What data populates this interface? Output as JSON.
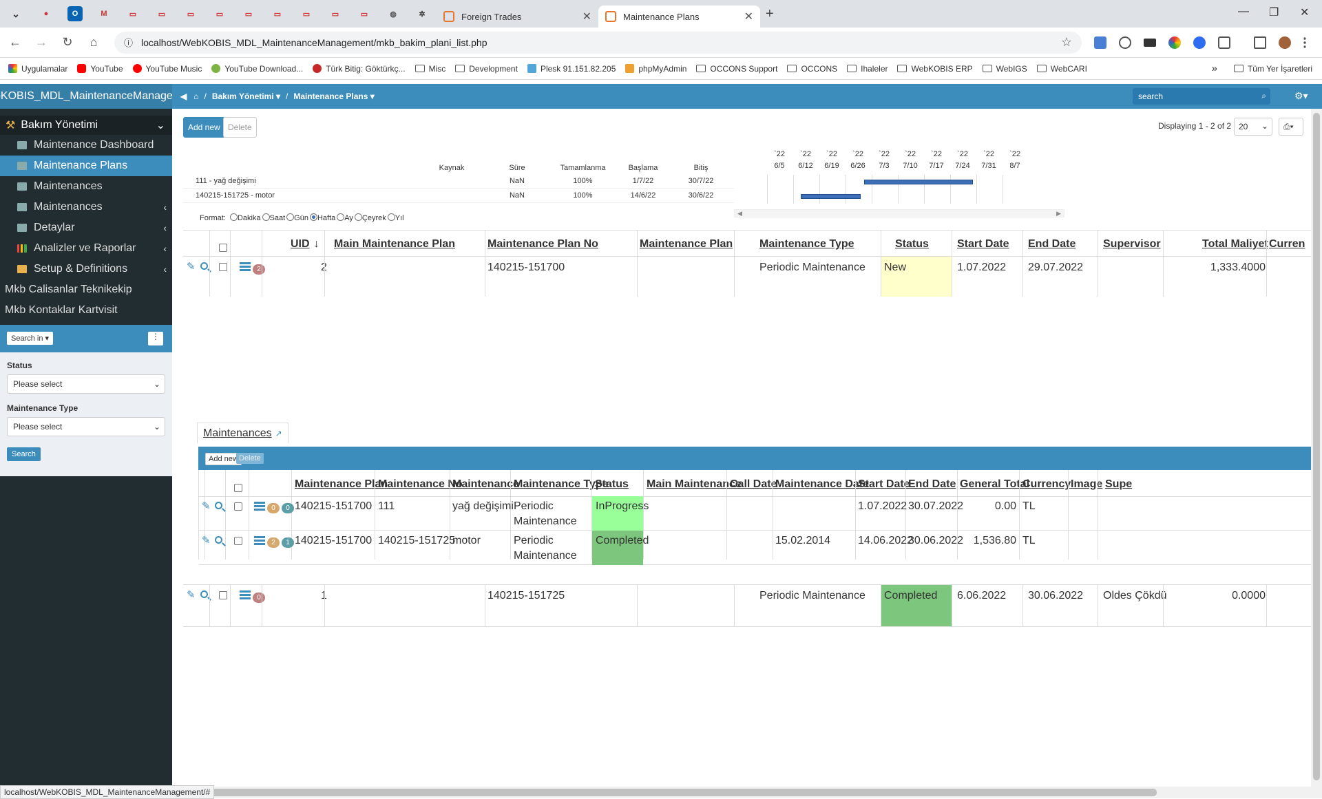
{
  "browser": {
    "tabs": [
      {
        "label": "Foreign Trades"
      },
      {
        "label": "Maintenance Plans"
      }
    ],
    "url": "localhost/WebKOBIS_MDL_MaintenanceManagement/mkb_bakim_plani_list.php",
    "bookmarks": [
      "Uygulamalar",
      "YouTube",
      "YouTube Music",
      "YouTube Download...",
      "Türk Bitig: Göktürkç...",
      "Misc",
      "Development",
      "Plesk 91.151.82.205",
      "phpMyAdmin",
      "OCCONS Support",
      "OCCONS",
      "Ihaleler",
      "WebKOBIS ERP",
      "WebIGS",
      "WebCARI"
    ],
    "bookmarks_more": "»",
    "other_bookmarks": "Tüm Yer İşaretleri",
    "status_url": "localhost/WebKOBIS_MDL_MaintenanceManagement/#"
  },
  "app": {
    "brand": "bKOBIS_MDL_MaintenanceManagem",
    "breadcrumb": [
      "Bakım Yönetimi",
      "Maintenance Plans"
    ],
    "search_placeholder": "search"
  },
  "sidebar": {
    "group": "Bakım Yönetimi",
    "items": [
      {
        "label": "Maintenance Dashboard",
        "active": false
      },
      {
        "label": "Maintenance Plans",
        "active": true
      },
      {
        "label": "Maintenances",
        "active": false
      },
      {
        "label": "Maintenances",
        "active": false
      },
      {
        "label": "Detaylar",
        "active": false
      },
      {
        "label": "Analizler ve Raporlar",
        "active": false
      },
      {
        "label": "Setup & Definitions",
        "active": false
      }
    ],
    "plain_items": [
      "Mkb Calisanlar Teknikekip",
      "Mkb Kontaklar Kartvisit"
    ],
    "search_in": "Search in",
    "filters": [
      {
        "label": "Status",
        "value": "Please select"
      },
      {
        "label": "Maintenance Type",
        "value": "Please select"
      }
    ],
    "search_button": "Search"
  },
  "toolbar": {
    "add_new": "Add new",
    "delete": "Delete",
    "displaying": "Displaying 1 - 2 of 2",
    "page_size": "20"
  },
  "gantt": {
    "columns": [
      "Kaynak",
      "Süre",
      "Tamamlanma",
      "Başlama",
      "Bitiş"
    ],
    "weeks": [
      "`22 6/5",
      "`22 6/12",
      "`22 6/19",
      "`22 6/26",
      "`22 7/3",
      "`22 7/10",
      "`22 7/17",
      "`22 7/24",
      "`22 7/31",
      "`22 8/7"
    ],
    "rows": [
      {
        "name": "111 - yağ değişimi",
        "kaynak": "",
        "sure": "NaN",
        "tamamlanma": "100%",
        "baslama": "1/7/22",
        "bitis": "30/7/22",
        "bar_start": "2022-07-01",
        "bar_end": "2022-07-30"
      },
      {
        "name": "140215-151725 - motor",
        "kaynak": "",
        "sure": "NaN",
        "tamamlanma": "100%",
        "baslama": "14/6/22",
        "bitis": "30/6/22",
        "bar_start": "2022-06-14",
        "bar_end": "2022-06-30"
      }
    ],
    "format_label": "Format:",
    "format_options": [
      "Dakika",
      "Saat",
      "Gün",
      "Hafta",
      "Ay",
      "Çeyrek",
      "Yıl"
    ],
    "format_selected": "Hafta"
  },
  "main_table": {
    "headers": [
      "UID",
      "Main Maintenance Plan",
      "Maintenance Plan No",
      "Maintenance Plan",
      "Maintenance Type",
      "Status",
      "Start Date",
      "End Date",
      "Supervisor",
      "Total Maliyet",
      "Curren"
    ],
    "rows": [
      {
        "badge": "2",
        "uid": "2",
        "main_plan": "",
        "plan_no": "140215-151700",
        "plan": "",
        "type": "Periodic Maintenance",
        "status": "New",
        "status_color": "#ffffcc",
        "start": "1.07.2022",
        "end": "29.07.2022",
        "supervisor": "",
        "total": "1,333.4000",
        "currency": ""
      },
      {
        "badge": "0",
        "uid": "1",
        "main_plan": "",
        "plan_no": "140215-151725",
        "plan": "",
        "type": "Periodic Maintenance",
        "status": "Completed",
        "status_color": "#7dc67d",
        "start": "6.06.2022",
        "end": "30.06.2022",
        "supervisor": "Oldes Çökdü",
        "total": "0.0000",
        "currency": ""
      }
    ]
  },
  "detail": {
    "tab_label": "Maintenances",
    "add_new": "Add new",
    "delete": "Delete",
    "headers": [
      "Maintenance Plan",
      "Maintenance No",
      "Maintenance",
      "Maintenance Type",
      "Status",
      "Main Maintenance",
      "Call Date",
      "Maintenance Date",
      "Start Date",
      "End Date",
      "General Total",
      "Currency",
      "Image",
      "Supe"
    ],
    "rows": [
      {
        "b1": "0",
        "b2": "0",
        "plan": "140215-151700",
        "no": "111",
        "maint": "yağ değişimi",
        "type1": "Periodic",
        "type2": "Maintenance",
        "status": "InProgress",
        "status_color": "#99ff99",
        "main": "",
        "call": "",
        "mdate": "",
        "start": "1.07.2022",
        "end": "30.07.2022",
        "total": "0.00",
        "currency": "TL"
      },
      {
        "b1": "2",
        "b2": "1",
        "plan": "140215-151700",
        "no": "140215-151725",
        "maint": "motor",
        "type1": "Periodic",
        "type2": "Maintenance",
        "status": "Completed",
        "status_color": "#7dc67d",
        "main": "",
        "call": "",
        "mdate": "15.02.2014",
        "start": "14.06.2022",
        "end": "30.06.2022",
        "total": "1,536.80",
        "currency": "TL"
      }
    ]
  },
  "colors": {
    "accent": "#3c8dbc",
    "sidebar": "#222d32",
    "bar": "#3d6fb6"
  }
}
